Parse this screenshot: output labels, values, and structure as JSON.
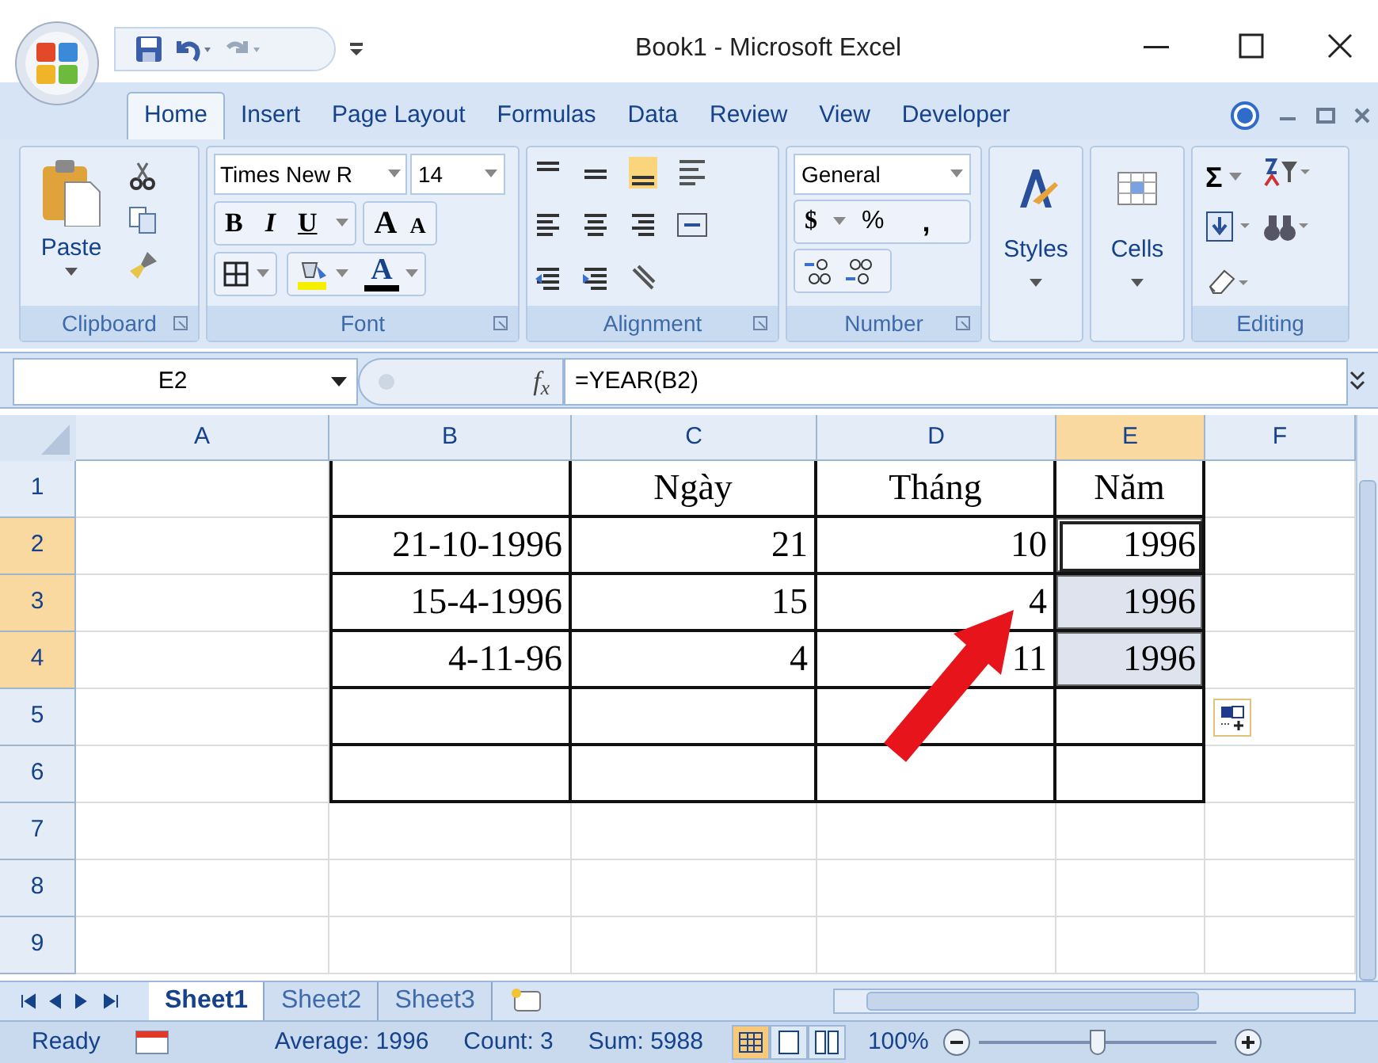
{
  "window": {
    "title": "Book1 - Microsoft Excel"
  },
  "ribbon": {
    "tabs": [
      {
        "label": "Home",
        "selected": true
      },
      {
        "label": "Insert",
        "selected": false
      },
      {
        "label": "Page Layout",
        "selected": false
      },
      {
        "label": "Formulas",
        "selected": false
      },
      {
        "label": "Data",
        "selected": false
      },
      {
        "label": "Review",
        "selected": false
      },
      {
        "label": "View",
        "selected": false
      },
      {
        "label": "Developer",
        "selected": false
      }
    ],
    "clipboard": {
      "paste": "Paste",
      "label": "Clipboard"
    },
    "font": {
      "name": "Times New R",
      "size": "14",
      "bold": "B",
      "italic": "I",
      "underline": "U",
      "grow": "A",
      "shrink": "A",
      "color_letter": "A",
      "label": "Font"
    },
    "alignment": {
      "label": "Alignment"
    },
    "number": {
      "format": "General",
      "currency": "$",
      "percent": "%",
      "comma": ",",
      "label": "Number"
    },
    "styles": {
      "button": "Styles"
    },
    "cells": {
      "button": "Cells"
    },
    "editing": {
      "sum": "Σ",
      "label": "Editing"
    }
  },
  "formula_bar": {
    "name_box": "E2",
    "fx": "f$_{x}$",
    "formula": "=YEAR(B2)"
  },
  "grid": {
    "columns": [
      {
        "label": "A",
        "selected": false,
        "bordered": false
      },
      {
        "label": "B",
        "selected": false,
        "bordered": true
      },
      {
        "label": "C",
        "selected": false,
        "bordered": true
      },
      {
        "label": "D",
        "selected": false,
        "bordered": true
      },
      {
        "label": "E",
        "selected": true,
        "bordered": true
      },
      {
        "label": "F",
        "selected": false,
        "bordered": false
      }
    ],
    "rows": [
      {
        "label": "1",
        "selected": false,
        "bordered": true,
        "cells": [
          null,
          null,
          {
            "text": "Ngày",
            "kind": "label",
            "selected": false,
            "active": false
          },
          {
            "text": "Tháng",
            "kind": "label",
            "selected": false,
            "active": false
          },
          {
            "text": "Năm",
            "kind": "label",
            "selected": false,
            "active": false
          },
          null
        ]
      },
      {
        "label": "2",
        "selected": true,
        "bordered": true,
        "cells": [
          null,
          {
            "text": "21-10-1996",
            "kind": "number",
            "selected": false,
            "active": false
          },
          {
            "text": "21",
            "kind": "number",
            "selected": false,
            "active": false
          },
          {
            "text": "10",
            "kind": "number",
            "selected": false,
            "active": false
          },
          {
            "text": "1996",
            "kind": "number",
            "selected": true,
            "active": true
          },
          null
        ]
      },
      {
        "label": "3",
        "selected": true,
        "bordered": true,
        "cells": [
          null,
          {
            "text": "15-4-1996",
            "kind": "number",
            "selected": false,
            "active": false
          },
          {
            "text": "15",
            "kind": "number",
            "selected": false,
            "active": false
          },
          {
            "text": "4",
            "kind": "number",
            "selected": false,
            "active": false
          },
          {
            "text": "1996",
            "kind": "number",
            "selected": true,
            "active": false
          },
          null
        ]
      },
      {
        "label": "4",
        "selected": true,
        "bordered": true,
        "cells": [
          null,
          {
            "text": "4-11-96",
            "kind": "number",
            "selected": false,
            "active": false
          },
          {
            "text": "4",
            "kind": "number",
            "selected": false,
            "active": false
          },
          {
            "text": "11",
            "kind": "number",
            "selected": false,
            "active": false
          },
          {
            "text": "1996",
            "kind": "number",
            "selected": true,
            "active": false
          },
          null
        ]
      },
      {
        "label": "5",
        "selected": false,
        "bordered": true
      },
      {
        "label": "6",
        "selected": false,
        "bordered": true
      },
      {
        "label": "7",
        "selected": false,
        "bordered": false
      },
      {
        "label": "8",
        "selected": false,
        "bordered": false
      },
      {
        "label": "9",
        "selected": false,
        "bordered": false
      }
    ]
  },
  "sheet_tabs": [
    {
      "label": "Sheet1",
      "selected": true
    },
    {
      "label": "Sheet2",
      "selected": false
    },
    {
      "label": "Sheet3",
      "selected": false
    }
  ],
  "status_bar": {
    "state": "Ready",
    "average": "Average: 1996",
    "count": "Count: 3",
    "sum": "Sum: 5988",
    "views": [
      {
        "selected": true
      },
      {
        "selected": false
      },
      {
        "selected": false
      }
    ],
    "zoom": "100%",
    "zoom_slider": {
      "level": 0.5
    }
  }
}
